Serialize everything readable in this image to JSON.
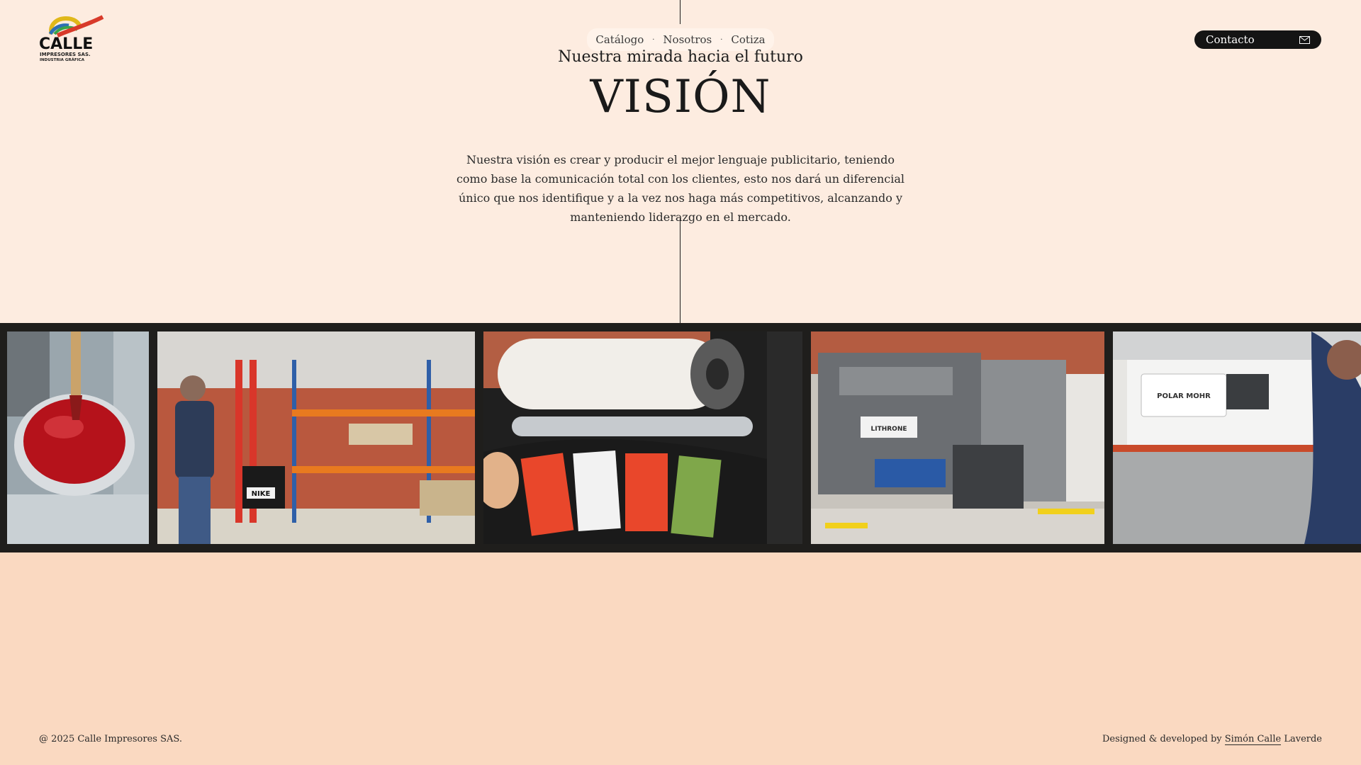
{
  "brand": {
    "logo_word": "CALLE",
    "logo_line1": "IMPRESORES SAS.",
    "logo_line2": "INDUSTRIA GRÁFICA"
  },
  "nav": {
    "items": [
      {
        "label": "Catálogo"
      },
      {
        "label": "Nosotros"
      },
      {
        "label": "Cotiza"
      }
    ],
    "separator": "·"
  },
  "contact": {
    "label": "Contacto",
    "icon": "mail-icon"
  },
  "hero": {
    "subtitle": "Nuestra mirada hacia el futuro",
    "title": "VISIÓN",
    "description": "Nuestra visión es crear y producir el mejor lenguaje publicitario, teniendo como base la comunicación total con los clientes, esto nos dará un diferencial único que nos identifique y a la vez nos haga más competitivos, alcanzando y manteniendo liderazgo en el mercado."
  },
  "gallery": {
    "photos": [
      {
        "name": "ink-bucket-photo"
      },
      {
        "name": "warehouse-forklift-photo"
      },
      {
        "name": "laminating-roll-photo"
      },
      {
        "name": "offset-press-photo"
      },
      {
        "name": "paper-cutter-photo"
      }
    ],
    "photo_labels": {
      "forklift_box": "NIKE",
      "press_brand": "LITHRONE",
      "cutter_brand": "POLAR MOHR"
    }
  },
  "footer": {
    "copyright": "@ 2025 Calle Impresores SAS.",
    "credit_prefix": "Designed & developed by ",
    "credit_link": "Simón Calle",
    "credit_suffix": " Laverde"
  },
  "colors": {
    "background_top": "#fdece0",
    "background_bottom": "#fad9c1",
    "gallery_bg": "#1f1e1c",
    "contact_bg": "#141414",
    "nav_bg": "#fff3ea"
  }
}
